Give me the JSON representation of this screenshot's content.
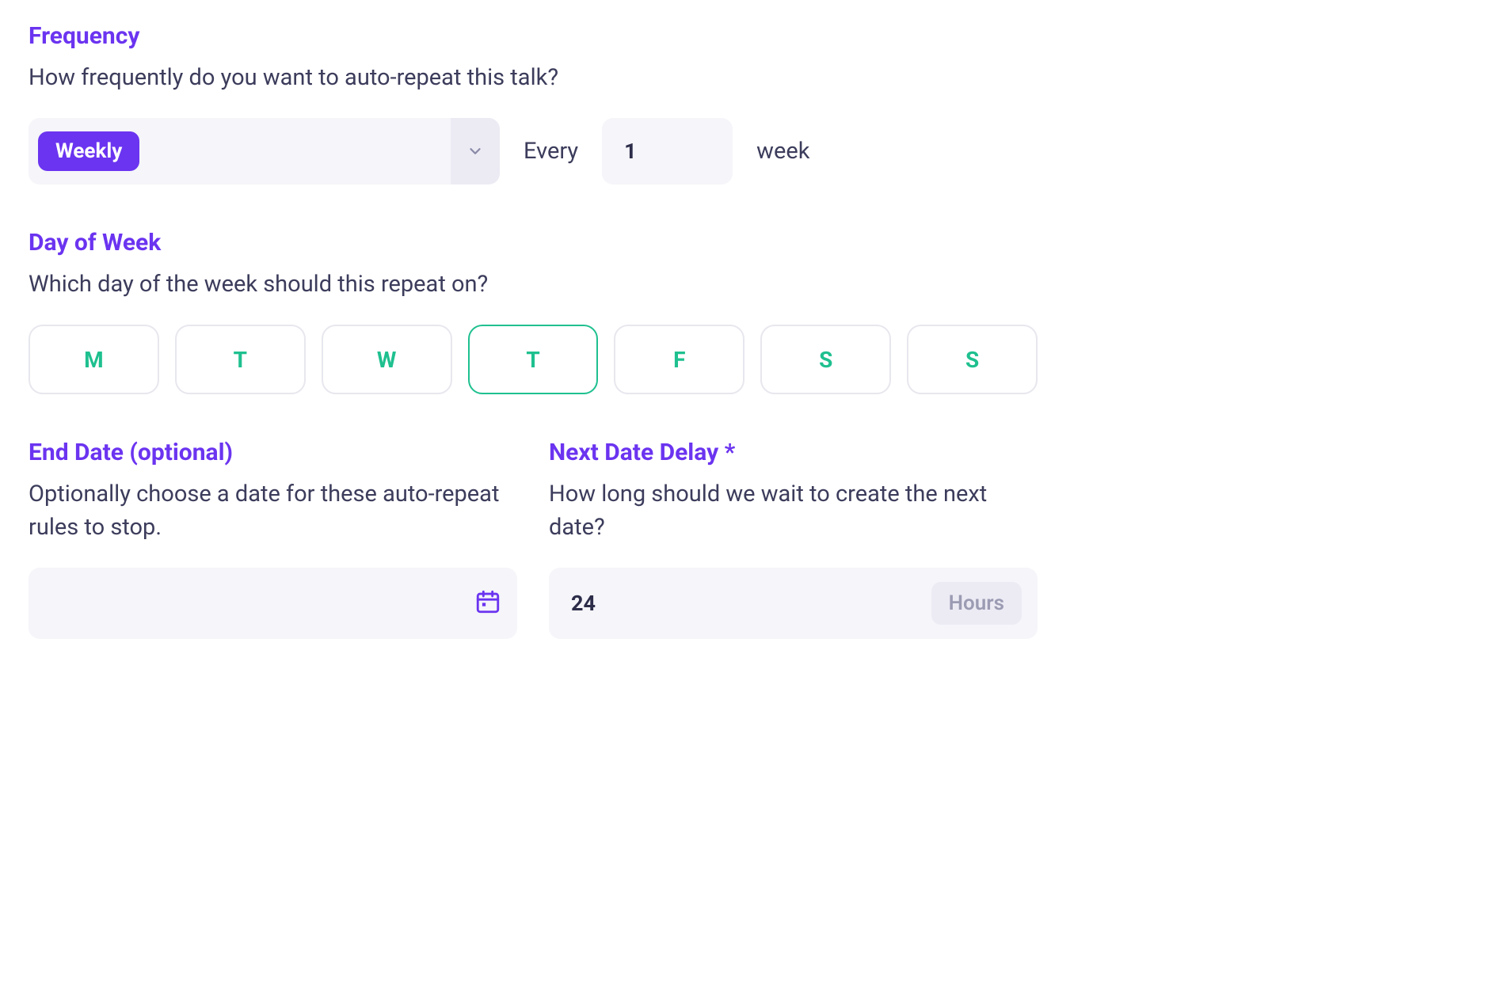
{
  "frequency": {
    "title": "Frequency",
    "description": "How frequently do you want to auto-repeat this talk?",
    "selected": "Weekly",
    "every_label": "Every",
    "every_value": "1",
    "unit_label": "week"
  },
  "dayOfWeek": {
    "title": "Day of Week",
    "description": "Which day of the week should this repeat on?",
    "days": [
      "M",
      "T",
      "W",
      "T",
      "F",
      "S",
      "S"
    ],
    "selectedIndex": 3
  },
  "endDate": {
    "title": "End Date (optional)",
    "description": "Optionally choose a date for these auto-repeat rules to stop.",
    "value": ""
  },
  "nextDelay": {
    "title": "Next Date Delay *",
    "description": "How long should we wait to create the next date?",
    "value": "24",
    "unit": "Hours"
  }
}
